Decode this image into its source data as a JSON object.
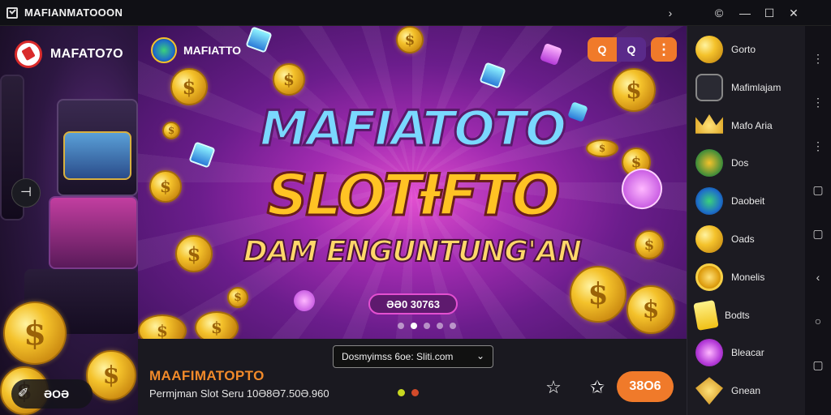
{
  "window": {
    "title": "MAFIANMATOOON",
    "ctrl_icons": [
      "expand-icon",
      "settings-icon",
      "minimize-icon",
      "maximize-icon",
      "close-icon"
    ]
  },
  "left_panel": {
    "brand_name": "MAFATO7O",
    "footer_text": "ƏOƏ"
  },
  "banner": {
    "brand_name": "MAFIATTO",
    "headline_1": "MAFIATOTO",
    "headline_2": "SLOTƗFTO",
    "headline_3": "DAM ENGUNTUNG'AN",
    "promo": "ƏƏ0 30763",
    "slide_count": 5,
    "active_slide": 1,
    "actions": {
      "search_label": "Q",
      "search2_label": "Q",
      "more_label": "⋮"
    }
  },
  "info_bar": {
    "url_value": "Dosmyimss 6oe: Sliti.com",
    "game_title": "MAAFIMATOPTO",
    "game_subtitle": "Permjman Slot Seru  10Ə8Ə7.50Ə.960",
    "play_label": "38O6",
    "status_colors": [
      "#c8d820",
      "#d24a2a"
    ]
  },
  "right_list": {
    "items": [
      {
        "label": "Gorto",
        "icon": "coin-icon"
      },
      {
        "label": "Mafimlajam",
        "icon": "machine-icon"
      },
      {
        "label": "Mafo Aria",
        "icon": "crown-icon"
      },
      {
        "label": "Dos",
        "icon": "character-icon"
      },
      {
        "label": "Daobeit",
        "icon": "globe-icon"
      },
      {
        "label": "Oads",
        "icon": "coin-icon"
      },
      {
        "label": "Monelis",
        "icon": "gold-coin-icon"
      },
      {
        "label": "Bodts",
        "icon": "card-icon"
      },
      {
        "label": "Bleacar",
        "icon": "purple-gem-icon"
      },
      {
        "label": "Gnean",
        "icon": "gold-gem-icon"
      }
    ]
  },
  "sys_icons": [
    "menu-icon",
    "grid-icon",
    "layers-icon",
    "square-icon",
    "copy-icon",
    "back-arrow-icon",
    "circle-icon",
    "square-outline-icon"
  ]
}
